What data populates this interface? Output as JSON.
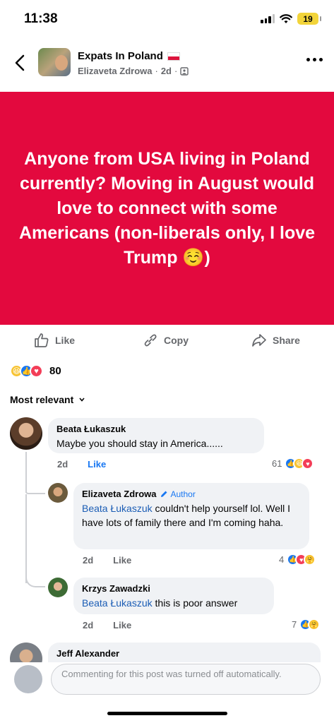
{
  "status": {
    "time": "11:38",
    "battery": "19"
  },
  "header": {
    "title": "Expats In Poland",
    "author": "Elizaveta Zdrowa",
    "age": "2d"
  },
  "post": {
    "text": "Anyone from USA living in Poland currently? Moving in August would\nlove to connect with some Americans (non-liberals only, I love Trump ☺️)",
    "background": "#e3093e"
  },
  "actions": {
    "like": "Like",
    "copy": "Copy",
    "share": "Share"
  },
  "reactions": {
    "count": "80"
  },
  "sort": {
    "label": "Most relevant"
  },
  "comments": [
    {
      "name": "Beata Łukaszuk",
      "text": "Maybe you should stay in America......",
      "age": "2d",
      "like": "Like",
      "reaction_count": "61"
    },
    {
      "name": "Elizaveta Zdrowa",
      "badge": "Author",
      "mention": "Beata Łukaszuk",
      "text": " couldn't help yourself lol. Well I have lots of family there and I'm coming haha.",
      "age": "2d",
      "like": "Like",
      "reaction_count": "4"
    },
    {
      "name": "Krzys Zawadzki",
      "mention": "Beata Łukaszuk",
      "text": " this is poor answer",
      "age": "2d",
      "like": "Like",
      "reaction_count": "7"
    },
    {
      "name": "Jeff Alexander"
    }
  ],
  "composer": {
    "placeholder": "Commenting for this post was turned off automatically."
  },
  "colors": {
    "accent": "#1877f2",
    "mention": "#1b5db5"
  }
}
